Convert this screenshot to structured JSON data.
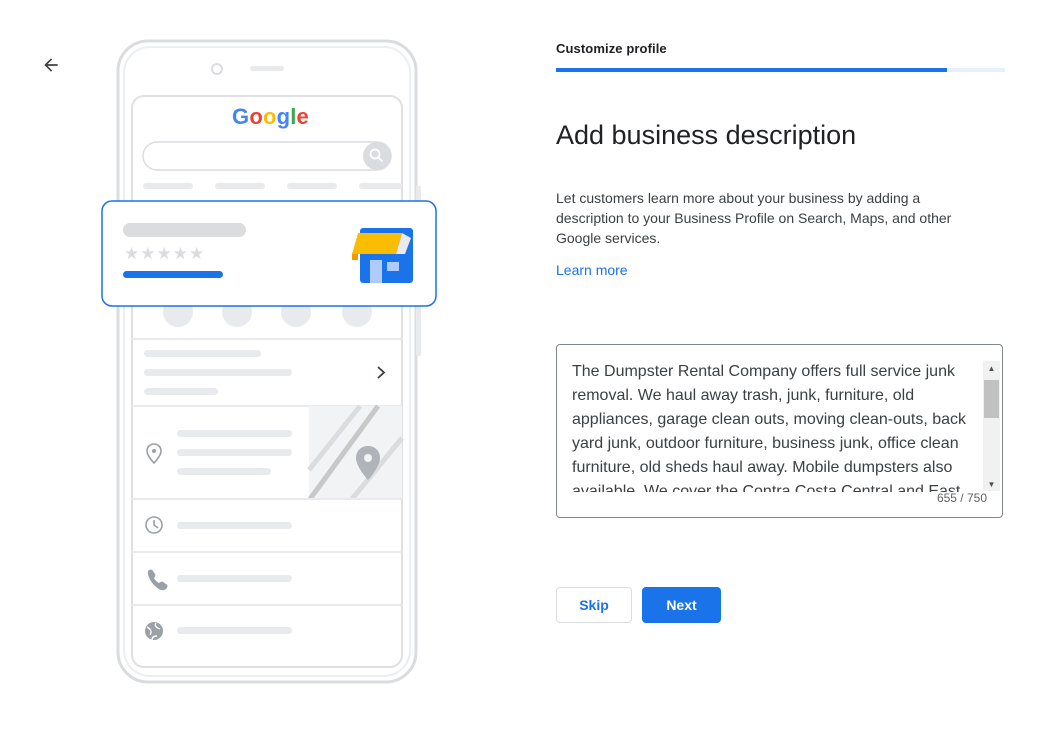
{
  "header": {
    "back_icon": "arrow-back-icon",
    "step_label": "Customize profile",
    "progress_fraction": 0.87
  },
  "illustration": {
    "logo_text": "Google",
    "rating_stars": "★★★★★",
    "store_icon": "storefront-icon",
    "annotation_icon": "red-arrow-icon",
    "accent_colors": {
      "red": "#E8131C",
      "blue": "#1A73E8",
      "yellow": "#FBBC04"
    }
  },
  "main": {
    "title": "Add business description",
    "description": "Let customers learn more about your business by adding a description to your Business Profile on Search, Maps, and other Google services.",
    "learn_more": "Learn more",
    "textarea_value": "The Dumpster Rental Company offers full service junk removal. We haul away trash, junk, furniture, old appliances, garage clean outs, moving clean-outs, back yard junk, outdoor furniture, business junk, office clean furniture, old sheds haul away. Mobile dumpsters also available. We cover the Contra Costa Central and East",
    "char_count": "655 / 750"
  },
  "actions": {
    "skip_label": "Skip",
    "next_label": "Next"
  }
}
